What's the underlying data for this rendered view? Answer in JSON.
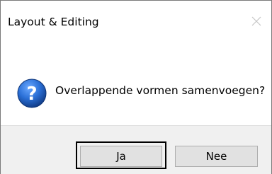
{
  "window": {
    "title": "Layout & Editing",
    "close_icon": "close-icon"
  },
  "content": {
    "icon": "question-icon",
    "message": "Overlappende vormen samenvoegen?"
  },
  "buttons": {
    "yes_label": "Ja",
    "no_label": "Nee",
    "default": "yes"
  },
  "colors": {
    "question_icon_blue": "#1f5fbf",
    "footer_bg": "#f0f0f0",
    "button_bg": "#e1e1e1",
    "button_border": "#adadad"
  }
}
